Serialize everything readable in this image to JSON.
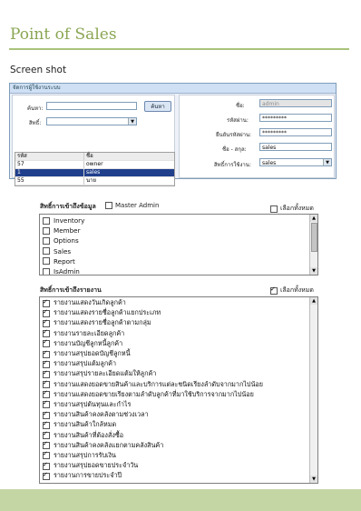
{
  "page": {
    "title": "Point of Sales",
    "section": "Screen shot"
  },
  "window": {
    "title": "จัดการผู้ใช้งานระบบ",
    "search": {
      "name_label": "ค้นหา:",
      "name_value": "",
      "search_button": "ค้นหา",
      "perm_label": "สิทธิ์:",
      "perm_value": ""
    },
    "grid": {
      "headers": [
        "รหัส",
        "ชื่อ"
      ],
      "rows": [
        [
          "57",
          "owner"
        ],
        [
          "1",
          "sales"
        ],
        [
          "55",
          "นาย"
        ]
      ]
    },
    "form": {
      "name_label": "ชื่อ:",
      "name_value": "admin",
      "password_label": "รหัสผ่าน:",
      "password_value": "*********",
      "confirm_label": "ยืนยันรหัสผ่าน:",
      "confirm_value": "*********",
      "fullname_label": "ชื่อ - สกุล:",
      "fullname_value": "sales",
      "role_label": "สิทธิ์การใช้งาน:",
      "role_value": "sales"
    }
  },
  "data_access": {
    "title": "สิทธิ์การเข้าถึงข้อมูล",
    "master_admin_label": "Master Admin",
    "select_all_label": "เลือกทั้งหมด",
    "items": [
      "Inventory",
      "Member",
      "Options",
      "Sales",
      "Report",
      "IsAdmin"
    ]
  },
  "report_access": {
    "title": "สิทธิ์การเข้าถึงรายงาน",
    "select_all_label": "เลือกทั้งหมด",
    "items": [
      "รายงานแสดงวันเกิดลูกค้า",
      "รายงานแสดงรายชื่อลูกค้าแยกประเภท",
      "รายงานแสดงรายชื่อลูกค้าตามกลุ่ม",
      "รายงานรายละเอียดลูกค้า",
      "รายงานบัญชีลูกหนี้ลูกค้า",
      "รายงานสรุปยอดบัญชีลูกหนี้",
      "รายงานสรุปแต้มลูกค้า",
      "รายงานสรุปรายละเอียดแต้มให้ลูกค้า",
      "รายงานแสดงยอดขายสินค้าและบริการแต่ละชนิดเรียงลำดับจากมากไปน้อย",
      "รายงานแสดงยอดขายเรียงตามลำดับลูกค้าที่มาใช้บริการจากมากไปน้อย",
      "รายงานสรุปต้นทุนและกำไร",
      "รายงานสินค้าคงคลังตามช่วงเวลา",
      "รายงานสินค้าใกล้หมด",
      "รายงานสินค้าที่ต้องสั่งซื้อ",
      "รายงานสินค้าคงคลังแยกตามคลังสินค้า",
      "รายงานสรุปการรับเงิน",
      "รายงานสรุปยอดขายประจำวัน",
      "รายงานการขายประจำปี"
    ]
  }
}
